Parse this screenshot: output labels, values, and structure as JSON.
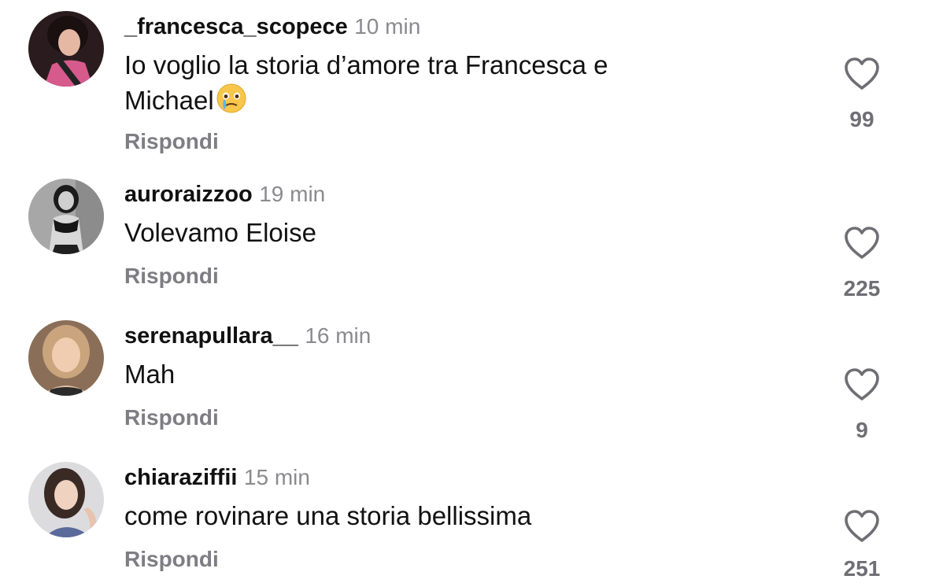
{
  "comments": [
    {
      "username": "_francesca_scopece",
      "time": "10 min",
      "text_line1": "Io voglio la storia d’amore tra Francesca e",
      "text_line2": "Michael",
      "emoji_icon": "face-holding-back-tears-icon",
      "reply_label": "Rispondi",
      "likes": "99",
      "avatar_colors": [
        "#2b1a1c",
        "#d65a8c"
      ]
    },
    {
      "username": "auroraizzoo",
      "time": "19 min",
      "text": "Volevamo Eloise",
      "reply_label": "Rispondi",
      "likes": "225",
      "avatar_colors": [
        "#9a9a9a",
        "#1d1d1d"
      ]
    },
    {
      "username": "serenapullara__",
      "time": "16 min",
      "text": "Mah",
      "reply_label": "Rispondi",
      "likes": "9",
      "avatar_colors": [
        "#a88a6e",
        "#e8c9a9"
      ]
    },
    {
      "username": "chiaraziffii",
      "time": "15 min",
      "text": "come rovinare una storia bellissima",
      "reply_label": "Rispondi",
      "likes": "251",
      "avatar_colors": [
        "#d9d9dc",
        "#3a2a24"
      ]
    }
  ],
  "colors": {
    "text": "#111111",
    "secondary": "#8a8a8f",
    "reply": "#7d7d83",
    "heart_stroke": "#6e6e74"
  }
}
